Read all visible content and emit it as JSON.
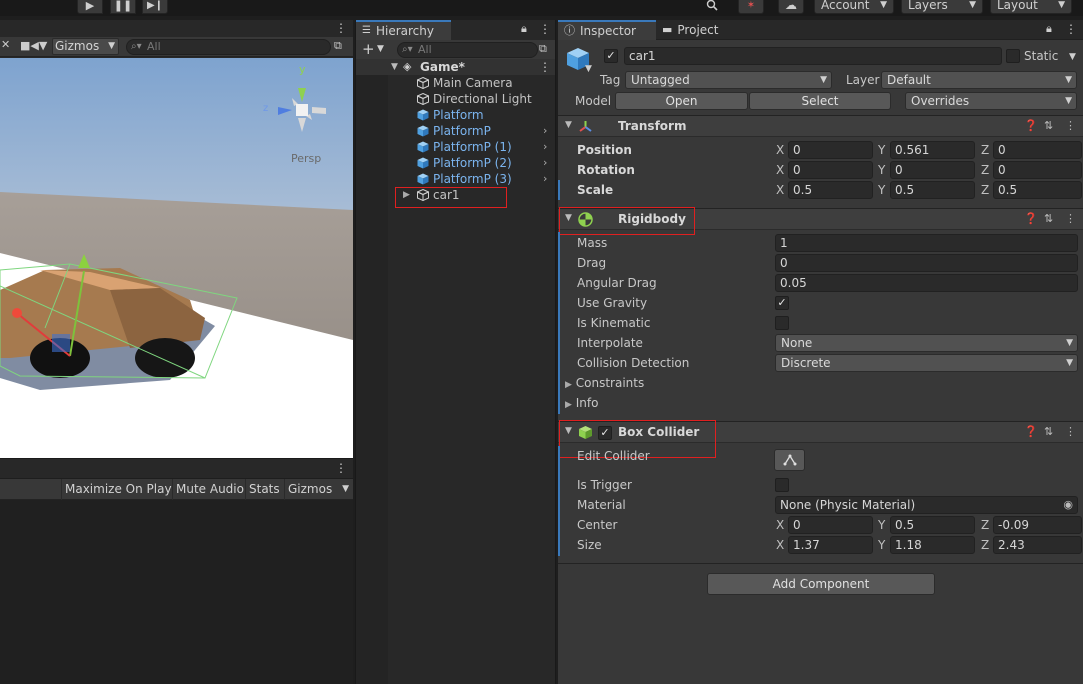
{
  "toolbar": {
    "account": "Account",
    "layers": "Layers",
    "layout": "Layout"
  },
  "scene": {
    "gizmos": "Gizmos",
    "search_placeholder": "All",
    "persp": "Persp",
    "gizmo_axes": {
      "y": "y",
      "z": "z"
    }
  },
  "game": {
    "maximize_on_play": "Maximize On Play",
    "mute_audio": "Mute Audio",
    "stats": "Stats",
    "gizmos": "Gizmos"
  },
  "hierarchy": {
    "tab": "Hierarchy",
    "search_placeholder": "All",
    "scene_name": "Game*",
    "items": [
      {
        "label": "Main Camera",
        "type": "object"
      },
      {
        "label": "Directional Light",
        "type": "object"
      },
      {
        "label": "Platform",
        "type": "prefab"
      },
      {
        "label": "PlatformP",
        "type": "prefab"
      },
      {
        "label": "PlatformP (1)",
        "type": "prefab"
      },
      {
        "label": "PlatformP (2)",
        "type": "prefab"
      },
      {
        "label": "PlatformP (3)",
        "type": "prefab"
      },
      {
        "label": "car1",
        "type": "object"
      }
    ]
  },
  "inspector": {
    "tab_inspector": "Inspector",
    "tab_project": "Project",
    "object_name": "car1",
    "static_label": "Static",
    "tag_label": "Tag",
    "tag_value": "Untagged",
    "layer_label": "Layer",
    "layer_value": "Default",
    "model_label": "Model",
    "open_button": "Open",
    "select_button": "Select",
    "overrides_button": "Overrides",
    "transform": {
      "title": "Transform",
      "position_label": "Position",
      "rotation_label": "Rotation",
      "scale_label": "Scale",
      "axis_x": "X",
      "axis_y": "Y",
      "axis_z": "Z",
      "position": {
        "x": "0",
        "y": "0.561",
        "z": "0"
      },
      "rotation": {
        "x": "0",
        "y": "0",
        "z": "0"
      },
      "scale": {
        "x": "0.5",
        "y": "0.5",
        "z": "0.5"
      }
    },
    "rigidbody": {
      "title": "Rigidbody",
      "mass_label": "Mass",
      "mass": "1",
      "drag_label": "Drag",
      "drag": "0",
      "angular_drag_label": "Angular Drag",
      "angular_drag": "0.05",
      "use_gravity_label": "Use Gravity",
      "use_gravity": "✓",
      "is_kinematic_label": "Is Kinematic",
      "interpolate_label": "Interpolate",
      "interpolate": "None",
      "collision_label": "Collision Detection",
      "collision": "Discrete",
      "constraints_label": "Constraints",
      "info_label": "Info"
    },
    "box_collider": {
      "title": "Box Collider",
      "edit_collider_label": "Edit Collider",
      "is_trigger_label": "Is Trigger",
      "material_label": "Material",
      "material": "None (Physic Material)",
      "center_label": "Center",
      "size_label": "Size",
      "center": {
        "x": "0",
        "y": "0.5",
        "z": "-0.09"
      },
      "size": {
        "x": "1.37",
        "y": "1.18",
        "z": "2.43"
      }
    },
    "add_component": "Add Component",
    "checkmark": "✓"
  },
  "colors": {
    "accent": "#3a79bb",
    "highlight_box": "#e02020",
    "prefab_text": "#7bb4ee"
  }
}
